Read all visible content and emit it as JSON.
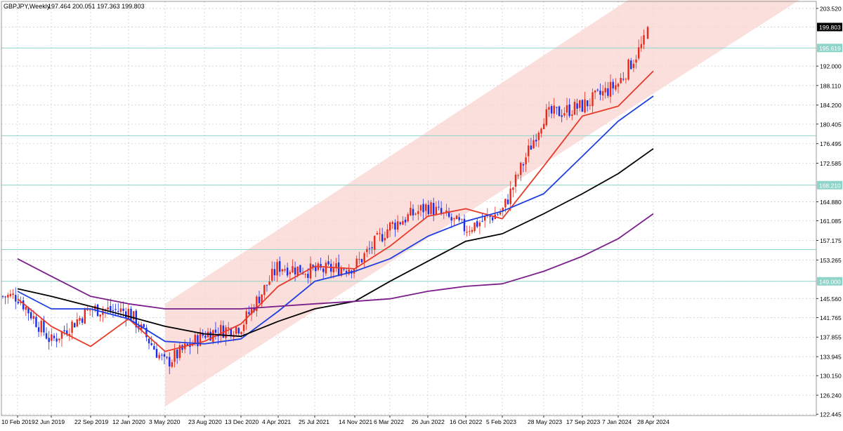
{
  "header": {
    "symbol": "GBPJPY,Weekly",
    "ohlc": "197.464 200.051 197.363 199.803"
  },
  "colors": {
    "up": "#e8291c",
    "down": "#1a2ee8",
    "ma_fast": "#e83a2a",
    "ma_mid": "#1f3fe0",
    "ma_slow": "#000000",
    "ma_long": "#7a1f8a",
    "channel": "#f8d4d0",
    "level": "#8fd4c8",
    "grid": "#c8c8c8"
  },
  "chart_data": {
    "type": "candlestick",
    "title": "GBPJPY,Weekly",
    "ohlc_last": {
      "open": 197.464,
      "high": 200.051,
      "low": 197.363,
      "close": 199.803
    },
    "ylim": [
      122.18,
      204.92
    ],
    "y_ticks": [
      "203.520",
      "199.803",
      "195.619",
      "192.000",
      "188.110",
      "184.200",
      "180.405",
      "176.495",
      "172.585",
      "168.210",
      "164.880",
      "161.085",
      "157.175",
      "153.265",
      "149.000",
      "145.560",
      "141.765",
      "137.855",
      "133.945",
      "130.150",
      "126.240",
      "122.445"
    ],
    "x_ticks": [
      "10 Feb 2019",
      "2 Jun 2019",
      "22 Sep 2019",
      "12 Jan 2020",
      "3 May 2020",
      "23 Aug 2020",
      "13 Dec 2020",
      "4 Apr 2021",
      "25 Jul 2021",
      "14 Nov 2021",
      "6 Mar 2022",
      "26 Jun 2022",
      "16 Oct 2022",
      "5 Feb 2023",
      "28 May 2023",
      "17 Sep 2023",
      "7 Jan 2024",
      "28 Apr 2024"
    ],
    "price_label": "199.803",
    "levels": [
      {
        "label": "195.619",
        "value": 195.619
      },
      {
        "label": "178.081",
        "value": 178.081
      },
      {
        "label": "168.210",
        "value": 168.21
      },
      {
        "label": "155.352",
        "value": 155.352
      },
      {
        "label": "149.000",
        "value": 149.0
      }
    ],
    "channel": {
      "lower_start": [
        "3 May 2020",
        124.0
      ],
      "lower_end": [
        "28 Apr 2024",
        186.5
      ],
      "upper_start": [
        "3 May 2020",
        144.5
      ],
      "upper_end": [
        "28 Apr 2024",
        208.5
      ]
    },
    "close_path": [
      [
        "10 Feb 2019",
        146.0
      ],
      [
        "2 Jun 2019",
        137.0
      ],
      [
        "22 Sep 2019",
        143.5
      ],
      [
        "12 Jan 2020",
        143.0
      ],
      [
        "3 May 2020",
        132.5
      ],
      [
        "23 Aug 2020",
        138.5
      ],
      [
        "13 Dec 2020",
        140.0
      ],
      [
        "4 Apr 2021",
        152.0
      ],
      [
        "25 Jul 2021",
        151.0
      ],
      [
        "14 Nov 2021",
        152.0
      ],
      [
        "6 Mar 2022",
        160.0
      ],
      [
        "26 Jun 2022",
        164.0
      ],
      [
        "16 Oct 2022",
        159.5
      ],
      [
        "5 Feb 2023",
        163.0
      ],
      [
        "28 May 2023",
        182.0
      ],
      [
        "17 Sep 2023",
        184.0
      ],
      [
        "7 Jan 2024",
        188.5
      ],
      [
        "28 Apr 2024",
        199.8
      ]
    ],
    "moving_averages": [
      {
        "color_key": "ma_fast",
        "points": [
          [
            "10 Feb 2019",
            145.5
          ],
          [
            "2 Jun 2019",
            140.0
          ],
          [
            "22 Sep 2019",
            136.0
          ],
          [
            "12 Jan 2020",
            141.5
          ],
          [
            "3 May 2020",
            135.0
          ],
          [
            "23 Aug 2020",
            137.0
          ],
          [
            "13 Dec 2020",
            140.5
          ],
          [
            "4 Apr 2021",
            148.0
          ],
          [
            "25 Jul 2021",
            152.0
          ],
          [
            "14 Nov 2021",
            151.5
          ],
          [
            "6 Mar 2022",
            156.0
          ],
          [
            "26 Jun 2022",
            162.0
          ],
          [
            "16 Oct 2022",
            163.5
          ],
          [
            "5 Feb 2023",
            161.5
          ],
          [
            "28 May 2023",
            172.0
          ],
          [
            "17 Sep 2023",
            182.0
          ],
          [
            "7 Jan 2024",
            184.0
          ],
          [
            "28 Apr 2024",
            191.0
          ]
        ]
      },
      {
        "color_key": "ma_mid",
        "points": [
          [
            "10 Feb 2019",
            147.0
          ],
          [
            "2 Jun 2019",
            143.5
          ],
          [
            "22 Sep 2019",
            143.5
          ],
          [
            "12 Jan 2020",
            141.5
          ],
          [
            "3 May 2020",
            137.0
          ],
          [
            "23 Aug 2020",
            136.5
          ],
          [
            "13 Dec 2020",
            137.5
          ],
          [
            "4 Apr 2021",
            143.0
          ],
          [
            "25 Jul 2021",
            149.0
          ],
          [
            "14 Nov 2021",
            151.0
          ],
          [
            "6 Mar 2022",
            153.5
          ],
          [
            "26 Jun 2022",
            158.0
          ],
          [
            "16 Oct 2022",
            161.0
          ],
          [
            "5 Feb 2023",
            163.0
          ],
          [
            "28 May 2023",
            166.5
          ],
          [
            "17 Sep 2023",
            174.0
          ],
          [
            "7 Jan 2024",
            181.0
          ],
          [
            "28 Apr 2024",
            186.0
          ]
        ]
      },
      {
        "color_key": "ma_slow",
        "points": [
          [
            "10 Feb 2019",
            147.5
          ],
          [
            "2 Jun 2019",
            146.0
          ],
          [
            "22 Sep 2019",
            144.0
          ],
          [
            "12 Jan 2020",
            142.0
          ],
          [
            "3 May 2020",
            140.0
          ],
          [
            "23 Aug 2020",
            138.5
          ],
          [
            "13 Dec 2020",
            138.0
          ],
          [
            "4 Apr 2021",
            141.0
          ],
          [
            "25 Jul 2021",
            143.5
          ],
          [
            "14 Nov 2021",
            145.0
          ],
          [
            "6 Mar 2022",
            149.0
          ],
          [
            "26 Jun 2022",
            153.0
          ],
          [
            "16 Oct 2022",
            157.0
          ],
          [
            "5 Feb 2023",
            158.5
          ],
          [
            "28 May 2023",
            162.5
          ],
          [
            "17 Sep 2023",
            166.5
          ],
          [
            "7 Jan 2024",
            170.5
          ],
          [
            "28 Apr 2024",
            175.5
          ]
        ]
      },
      {
        "color_key": "ma_long",
        "points": [
          [
            "10 Feb 2019",
            153.5
          ],
          [
            "2 Jun 2019",
            150.0
          ],
          [
            "22 Sep 2019",
            146.0
          ],
          [
            "12 Jan 2020",
            144.5
          ],
          [
            "3 May 2020",
            143.5
          ],
          [
            "23 Aug 2020",
            143.5
          ],
          [
            "13 Dec 2020",
            143.5
          ],
          [
            "4 Apr 2021",
            144.0
          ],
          [
            "25 Jul 2021",
            144.5
          ],
          [
            "14 Nov 2021",
            145.0
          ],
          [
            "6 Mar 2022",
            145.5
          ],
          [
            "26 Jun 2022",
            147.0
          ],
          [
            "16 Oct 2022",
            148.0
          ],
          [
            "5 Feb 2023",
            148.5
          ],
          [
            "28 May 2023",
            151.0
          ],
          [
            "17 Sep 2023",
            154.0
          ],
          [
            "7 Jan 2024",
            157.5
          ],
          [
            "28 Apr 2024",
            162.5
          ]
        ]
      }
    ],
    "grid": true
  }
}
